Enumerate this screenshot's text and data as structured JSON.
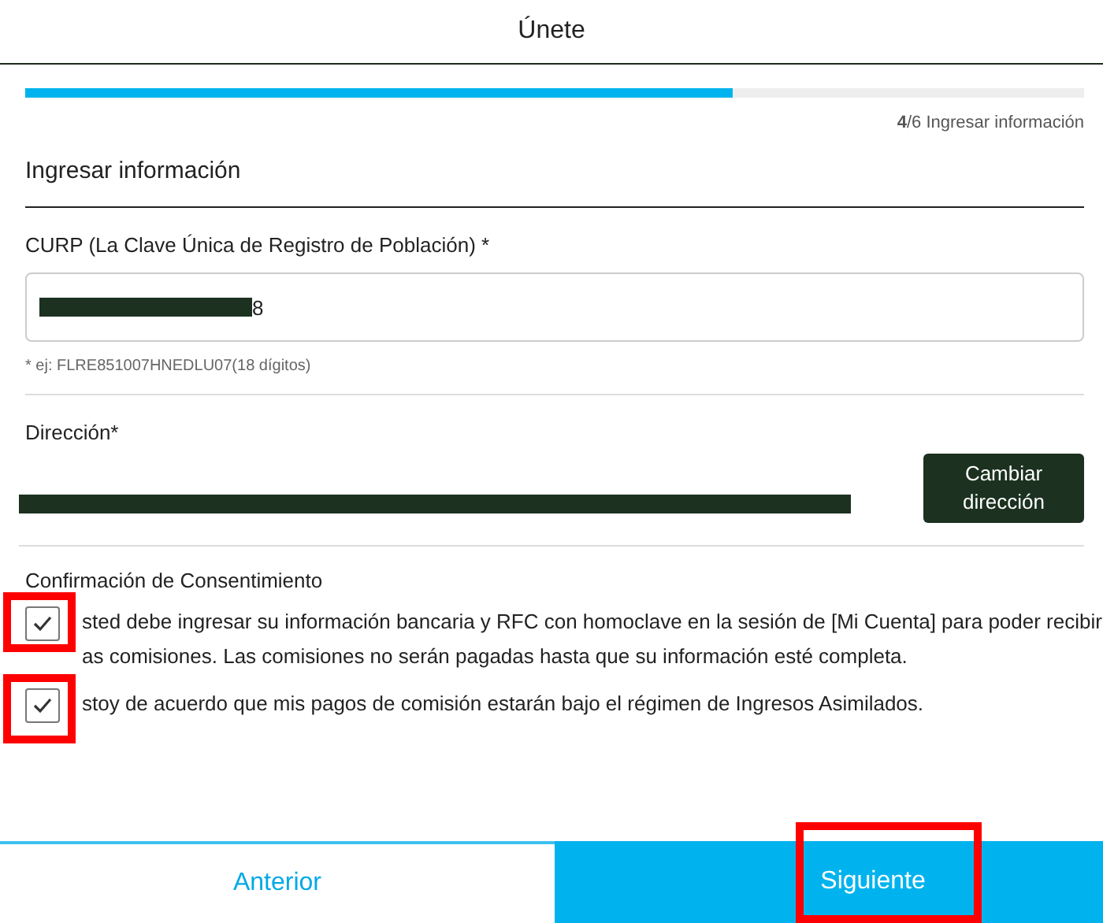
{
  "window": {
    "title": "Únete"
  },
  "progress": {
    "level": 0.668,
    "step": "**4**/6 Ingresar información"
  },
  "section_title": "Ingresar información",
  "curp": {
    "label": "CURP (La Clave Única de Registro de Población) *",
    "value": "8",
    "hint": "* ej: FLRE851007HNEDLU07(18 dígitos)"
  },
  "address": {
    "label": "Dirección*",
    "button": "Cambiar dirección"
  },
  "consent": {
    "title": "Confirmación de Consentimiento",
    "items": [
      {
        "lines": [
          "sted debe ingresar su información bancaria y RFC con homoclave en la sesión de [Mi Cuenta] para poder recibir",
          "as comisiones. Las comisiones no serán pagadas hasta que su información esté completa."
        ],
        "checked": true,
        "highlighted": true
      },
      {
        "lines": [
          "stoy de acuerdo que mis pagos de comisión estarán bajo el régimen de Ingresos Asimilados."
        ],
        "checked": true,
        "highlighted": true
      }
    ]
  },
  "footer": {
    "buttons": [
      {
        "label": "Anterior",
        "kind": "secondary",
        "highlighted": false
      },
      {
        "label": "Siguiente",
        "kind": "primary",
        "highlighted": true
      }
    ]
  }
}
